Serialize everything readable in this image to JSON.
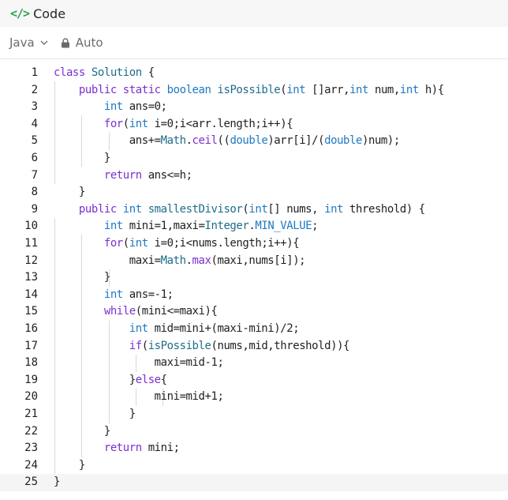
{
  "header": {
    "title": "Code",
    "code_glyph": "</>"
  },
  "toolbar": {
    "language": "Java",
    "mode": "Auto"
  },
  "colors": {
    "accent_green": "#2ca24c",
    "keyword": "#7b30d0",
    "type": "#1e79c2"
  },
  "editor": {
    "line_numbers": [
      "1",
      "2",
      "3",
      "4",
      "5",
      "6",
      "7",
      "8",
      "9",
      "10",
      "11",
      "12",
      "13",
      "14",
      "15",
      "16",
      "17",
      "18",
      "19",
      "20",
      "21",
      "22",
      "23",
      "24",
      "25"
    ],
    "lines": [
      "class Solution {",
      "    public static boolean isPossible(int []arr,int num,int h){",
      "        int ans=0;",
      "        for(int i=0;i<arr.length;i++){",
      "            ans+=Math.ceil((double)arr[i]/(double)num);",
      "        }",
      "        return ans<=h;",
      "    }",
      "    public int smallestDivisor(int[] nums, int threshold) {",
      "        int mini=1,maxi=Integer.MIN_VALUE;",
      "        for(int i=0;i<nums.length;i++){",
      "            maxi=Math.max(maxi,nums[i]);",
      "        }",
      "        int ans=-1;",
      "        while(mini<=maxi){",
      "            int mid=mini+(maxi-mini)/2;",
      "            if(isPossible(nums,mid,threshold)){",
      "                maxi=mid-1;",
      "            }else{",
      "                mini=mid+1;",
      "            }",
      "        }",
      "        return mini;",
      "    }",
      "}"
    ]
  }
}
